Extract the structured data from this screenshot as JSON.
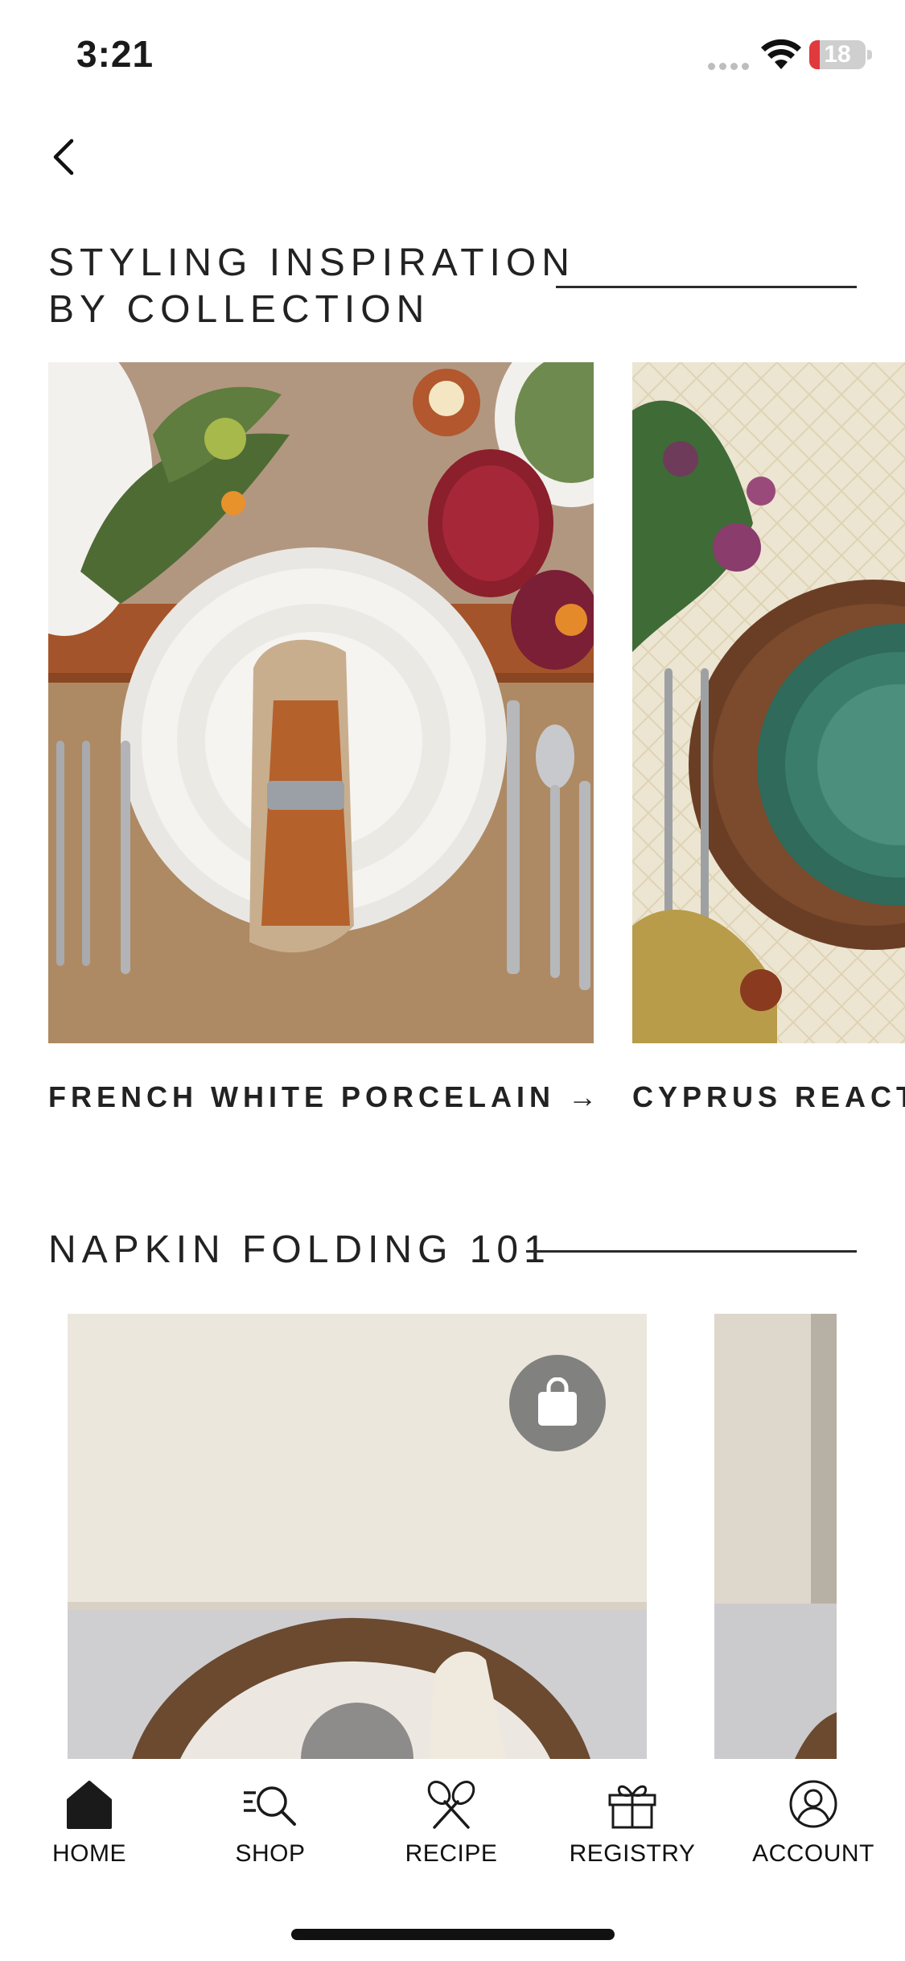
{
  "status_bar": {
    "time": "3:21",
    "battery": "18",
    "battery_level": 0.18
  },
  "sections": [
    {
      "title_line1": "STYLING INSPIRATION",
      "title_line2": "BY COLLECTION"
    },
    {
      "title": "NAPKIN FOLDING 101"
    }
  ],
  "collections": [
    {
      "label": "FRENCH WHITE PORCELAIN →"
    },
    {
      "label": "CYPRUS REACT"
    }
  ],
  "tabs": [
    {
      "label": "HOME",
      "icon": "home-icon"
    },
    {
      "label": "SHOP",
      "icon": "search-list-icon"
    },
    {
      "label": "RECIPE",
      "icon": "whisk-icon"
    },
    {
      "label": "REGISTRY",
      "icon": "gift-icon"
    },
    {
      "label": "ACCOUNT",
      "icon": "account-icon"
    }
  ],
  "colors": {
    "accent_dark": "#111111",
    "battery_low": "#e0393e",
    "rule": "#2b2b2b"
  }
}
